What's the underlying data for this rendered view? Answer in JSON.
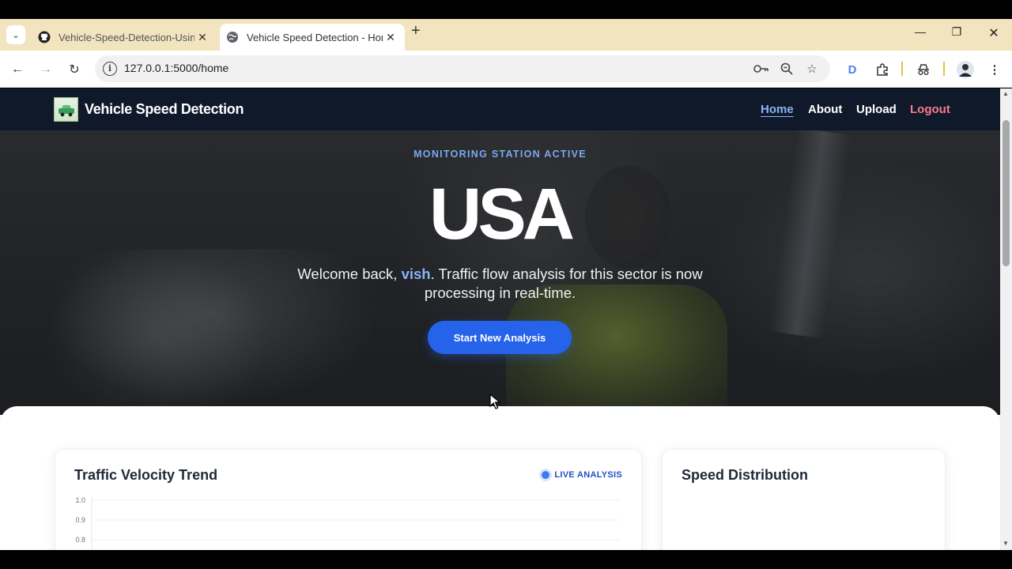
{
  "browser": {
    "tabs": [
      {
        "title": "Vehicle-Speed-Detection-Using",
        "active": false
      },
      {
        "title": "Vehicle Speed Detection - Hom",
        "active": true
      }
    ],
    "url": "127.0.0.1:5000/home",
    "extension_initial": "D"
  },
  "navbar": {
    "brand": "Vehicle Speed Detection",
    "links": [
      {
        "label": "Home",
        "active": true
      },
      {
        "label": "About"
      },
      {
        "label": "Upload"
      },
      {
        "label": "Logout"
      }
    ]
  },
  "hero": {
    "kicker": "MONITORING STATION ACTIVE",
    "title": "USA",
    "text_before": "Welcome back, ",
    "username": "vish",
    "text_after": ". Traffic flow analysis for this sector is now processing in real-time.",
    "button": "Start New Analysis"
  },
  "cards": {
    "trend_title": "Traffic Velocity Trend",
    "live_badge": "LIVE ANALYSIS",
    "distribution_title": "Speed Distribution"
  },
  "chart_data": {
    "type": "line",
    "title": "Traffic Velocity Trend",
    "series": [],
    "y_ticks": [
      "1.0",
      "0.9",
      "0.8"
    ],
    "ylim": [
      0.8,
      1.0
    ],
    "grid": true
  },
  "colors": {
    "navbar_bg": "#10192a",
    "accent": "#2563eb",
    "active_link": "#8ab4f8",
    "logout": "#f77b8f"
  }
}
